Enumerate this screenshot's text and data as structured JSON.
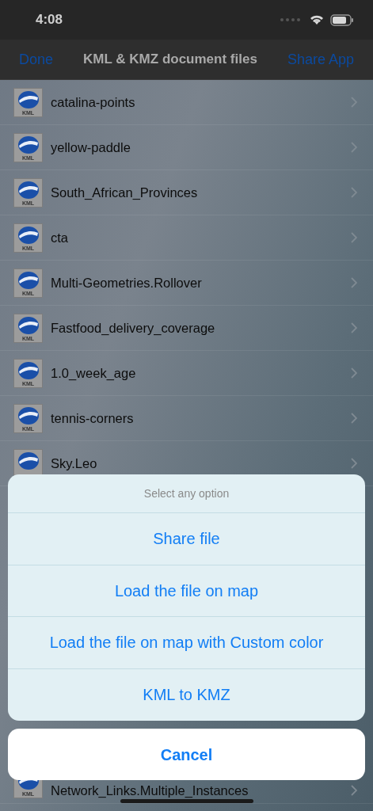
{
  "status_bar": {
    "time": "4:08"
  },
  "nav_bar": {
    "left_button": "Done",
    "title": "KML & KMZ document files",
    "right_button": "Share App"
  },
  "files": [
    {
      "name": "catalina-points",
      "icon_label": "KML"
    },
    {
      "name": "yellow-paddle",
      "icon_label": "KML"
    },
    {
      "name": "South_African_Provinces",
      "icon_label": "KML"
    },
    {
      "name": "cta",
      "icon_label": "KML"
    },
    {
      "name": "Multi-Geometries.Rollover",
      "icon_label": "KML"
    },
    {
      "name": "Fastfood_delivery_coverage",
      "icon_label": "KML"
    },
    {
      "name": "1.0_week_age",
      "icon_label": "KML"
    },
    {
      "name": "tennis-corners",
      "icon_label": "KML"
    },
    {
      "name": "Sky.Leo"
    }
  ],
  "bottom_files": [
    {
      "name": "Network_Links.Multiple_Instances",
      "icon_label": "KML"
    }
  ],
  "action_sheet": {
    "title": "Select any option",
    "options": [
      "Share file",
      "Load the file on map",
      "Load the file on map with Custom color",
      "KML to KMZ"
    ],
    "cancel": "Cancel"
  }
}
